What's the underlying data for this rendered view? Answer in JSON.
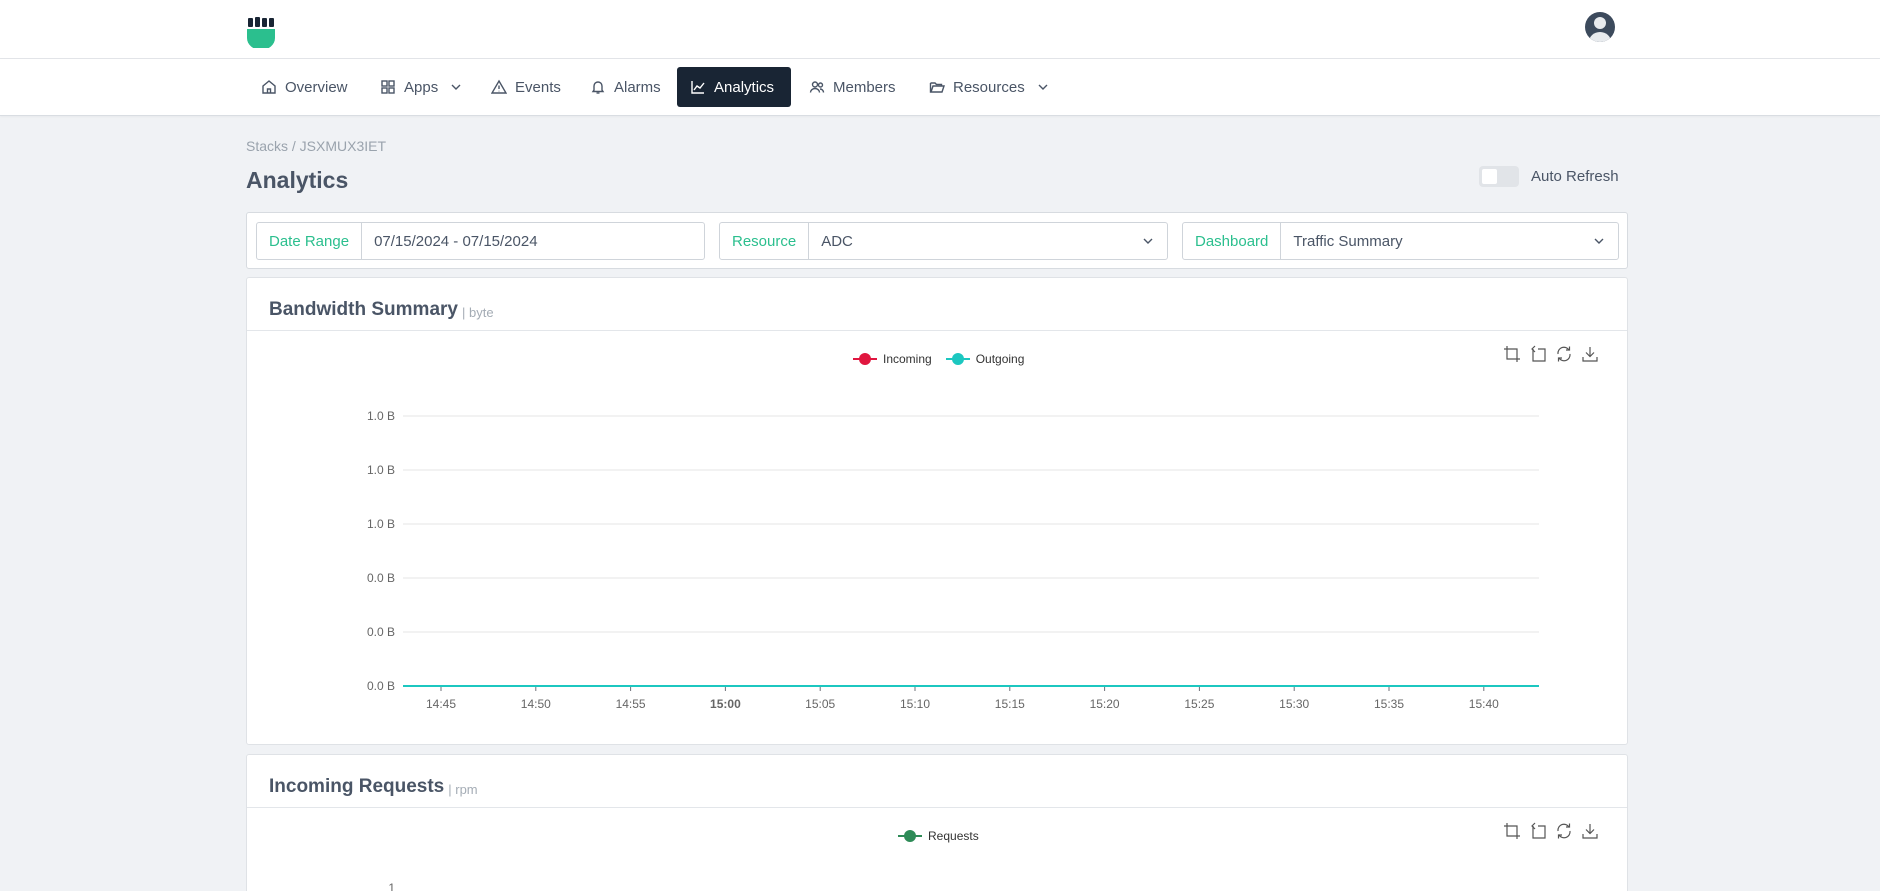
{
  "nav": {
    "items": [
      {
        "label": "Overview",
        "icon": "home-icon"
      },
      {
        "label": "Apps",
        "icon": "grid-icon",
        "dropdown": true
      },
      {
        "label": "Events",
        "icon": "warning-icon"
      },
      {
        "label": "Alarms",
        "icon": "bell-icon"
      },
      {
        "label": "Analytics",
        "icon": "chart-line-icon",
        "active": true
      },
      {
        "label": "Members",
        "icon": "users-icon"
      },
      {
        "label": "Resources",
        "icon": "folder-icon",
        "dropdown": true
      }
    ]
  },
  "breadcrumb": "Stacks / JSXMUX3IET",
  "page": {
    "title": "Analytics"
  },
  "auto_refresh": {
    "label": "Auto Refresh",
    "enabled": false
  },
  "filters": {
    "date_range": {
      "label": "Date Range",
      "value": "07/15/2024 - 07/15/2024"
    },
    "resource": {
      "label": "Resource",
      "value": "ADC"
    },
    "dashboard": {
      "label": "Dashboard",
      "value": "Traffic Summary"
    }
  },
  "panels": {
    "bandwidth": {
      "title": "Bandwidth Summary",
      "unit": "| byte"
    },
    "requests": {
      "title": "Incoming Requests",
      "unit": "| rpm"
    }
  },
  "colors": {
    "accent": "#2bbf8e",
    "incoming": "#e0163f",
    "outgoing": "#1cc7c0",
    "requests": "#2e8b57",
    "nav_active": "#192534"
  },
  "chart_data": [
    {
      "type": "line",
      "legend_position": "top",
      "grid": true,
      "x": [
        "14:45",
        "14:50",
        "14:55",
        "15:00",
        "15:05",
        "15:10",
        "15:15",
        "15:20",
        "15:25",
        "15:30",
        "15:35",
        "15:40"
      ],
      "x_emphasized": "15:00",
      "y_tick_labels": [
        "0.0 B",
        "0.0 B",
        "0.0 B",
        "1.0 B",
        "1.0 B",
        "1.0 B"
      ],
      "ylim": [
        0,
        1
      ],
      "series": [
        {
          "name": "Incoming",
          "values": [
            0,
            0,
            0,
            0,
            0,
            0,
            0,
            0,
            0,
            0,
            0,
            0
          ]
        },
        {
          "name": "Outgoing",
          "values": [
            0,
            0,
            0,
            0,
            0,
            0,
            0,
            0,
            0,
            0,
            0,
            0
          ]
        }
      ]
    },
    {
      "type": "line",
      "legend_position": "top",
      "y_tick_labels": [
        "1"
      ],
      "series": [
        {
          "name": "Requests",
          "values": []
        }
      ]
    }
  ]
}
